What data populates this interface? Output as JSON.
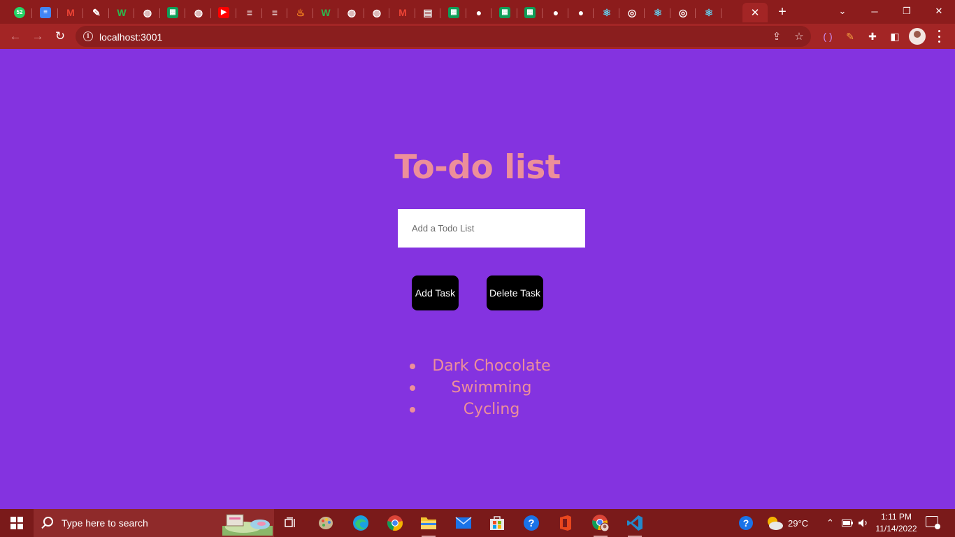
{
  "browser": {
    "tab_favicons": [
      {
        "icon": "whatsapp-icon",
        "badge": "52",
        "color": "#25d366"
      },
      {
        "icon": "docs-icon",
        "color": "#4285f4"
      },
      {
        "icon": "gmail-icon",
        "color": "#ea4335"
      },
      {
        "icon": "pen-icon",
        "color": "#ffffff"
      },
      {
        "icon": "w-icon",
        "color": "#2db84d"
      },
      {
        "icon": "globe-icon",
        "color": "#ffffff"
      },
      {
        "icon": "sheets-icon",
        "color": "#0f9d58"
      },
      {
        "icon": "globe-icon",
        "color": "#ffffff"
      },
      {
        "icon": "youtube-icon",
        "color": "#ff0000"
      },
      {
        "icon": "stack-icon",
        "color": "#ffffff"
      },
      {
        "icon": "stack-icon",
        "color": "#ffffff"
      },
      {
        "icon": "fire-icon",
        "color": "#f58220"
      },
      {
        "icon": "w-icon",
        "color": "#2db84d"
      },
      {
        "icon": "globe-icon",
        "color": "#ffffff"
      },
      {
        "icon": "globe-icon",
        "color": "#ffffff"
      },
      {
        "icon": "gmail-icon",
        "color": "#ea4335"
      },
      {
        "icon": "notes-icon",
        "color": "#e8e8e8"
      },
      {
        "icon": "sheets-icon",
        "color": "#0f9d58"
      },
      {
        "icon": "github-icon",
        "color": "#ffffff"
      },
      {
        "icon": "sheets-icon",
        "color": "#0f9d58"
      },
      {
        "icon": "sheets-icon",
        "color": "#0f9d58"
      },
      {
        "icon": "github-icon",
        "color": "#ffffff"
      },
      {
        "icon": "github-icon",
        "color": "#ffffff"
      },
      {
        "icon": "react-icon",
        "color": "#61dafb"
      },
      {
        "icon": "chrome-icon",
        "color": "#ffffff"
      },
      {
        "icon": "react-icon",
        "color": "#61dafb"
      },
      {
        "icon": "chrome-icon",
        "color": "#ffffff"
      },
      {
        "icon": "react-icon",
        "color": "#61dafb"
      }
    ],
    "active_tab_close": "✕",
    "new_tab": "+",
    "url": "localhost:3001",
    "colors": {
      "tabstrip": "#8c1c1c",
      "toolbar": "#a32525"
    }
  },
  "app": {
    "title": "To-do list",
    "input": {
      "placeholder": "Add a Todo List",
      "value": ""
    },
    "add_button": "Add Task",
    "delete_button": "Delete Task",
    "tasks": [
      "Dark Chocolate",
      "Swimming",
      "Cycling"
    ],
    "colors": {
      "background": "#8433e0",
      "accent": "#ed8f9a",
      "button": "#000000"
    }
  },
  "taskbar": {
    "search_placeholder": "Type here to search",
    "pinned_apps": [
      "task-view-icon",
      "paint-icon",
      "edge-icon",
      "chrome-icon",
      "file-explorer-icon",
      "mail-icon",
      "store-icon",
      "help-icon",
      "office-icon",
      "chrome-profile-icon",
      "vscode-icon"
    ],
    "temperature": "29°C",
    "time": "1:11 PM",
    "date": "11/14/2022"
  }
}
